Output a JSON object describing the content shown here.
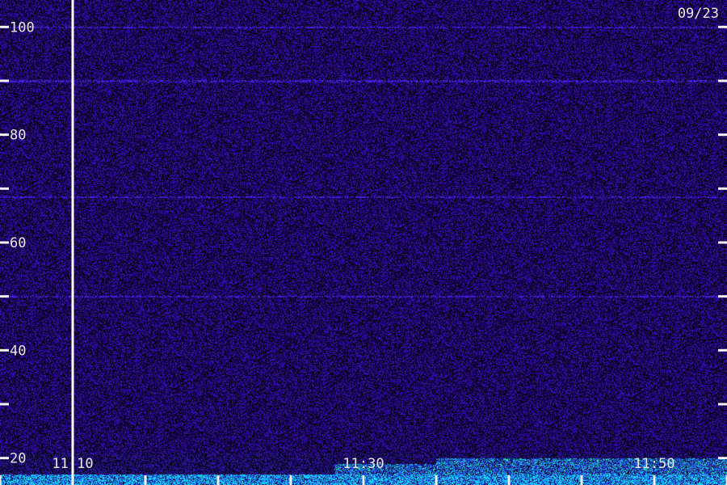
{
  "date_label": "09/23",
  "colors": {
    "background": "#000000",
    "low": "#3a0f8c",
    "mid": "#2f5bff",
    "high": "#19e0c8",
    "axis": "#f0f0f0"
  },
  "chart_data": {
    "type": "heatmap",
    "title": "",
    "xlabel": "",
    "ylabel": "",
    "ylim": [
      15,
      105
    ],
    "y_major_ticks": [
      20,
      40,
      60,
      80,
      100
    ],
    "y_minor_ticks": [
      30,
      50,
      70,
      90
    ],
    "y_tick_labels": [
      "20",
      "40",
      "60",
      "80",
      "100"
    ],
    "x_range": [
      "11:05",
      "11:55"
    ],
    "x_ticks": [
      "11:05",
      "11:10",
      "11:15",
      "11:20",
      "11:25",
      "11:30",
      "11:35",
      "11:40",
      "11:45",
      "11:50",
      "11:55"
    ],
    "x_tick_labels": [
      {
        "time": "11:10",
        "label": "11:10"
      },
      {
        "time": "11:30",
        "label": "11:30"
      },
      {
        "time": "11:50",
        "label": "11:50"
      }
    ],
    "marker_line_time": "11:10",
    "intensity_bands": [
      {
        "from": 15,
        "to": 17,
        "start": "11:05",
        "end": "11:55",
        "level": "high"
      },
      {
        "from": 17,
        "to": 19,
        "start": "11:28",
        "end": "11:55",
        "level": "mid"
      },
      {
        "from": 19,
        "to": 20,
        "start": "11:35",
        "end": "11:55",
        "level": "mid"
      }
    ],
    "horizontal_lines": [
      100,
      68.5,
      90,
      50,
      20
    ]
  }
}
